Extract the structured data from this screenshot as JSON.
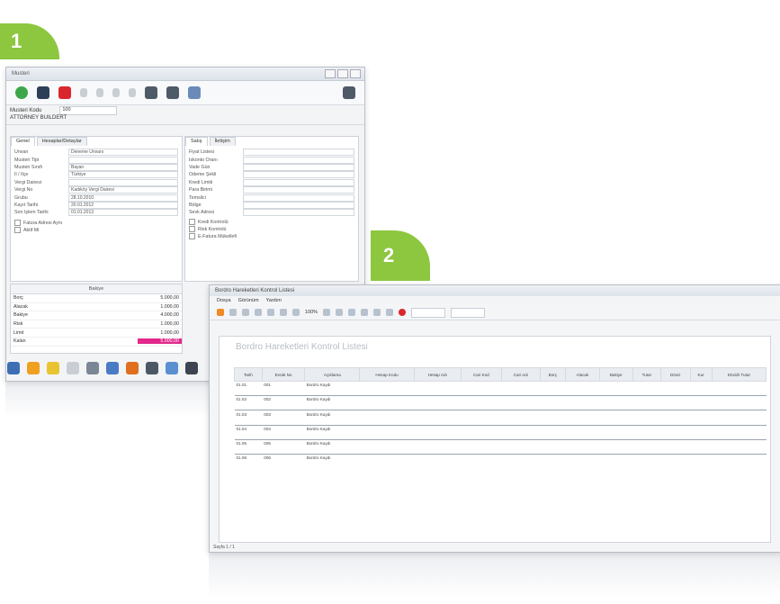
{
  "steps": {
    "one": "1",
    "two": "2"
  },
  "win1": {
    "title": "Musteri",
    "field_code_label": "Musteri Kodu",
    "field_code_value": "100",
    "company": "ATTORNEY BUILDERT",
    "left_tabs": [
      "Genel",
      "Hesaplar/Detaylar"
    ],
    "left_fields": [
      {
        "label": "Unvan",
        "value": "Deneme Unvanı"
      },
      {
        "label": "Musteri Tipi",
        "value": ""
      },
      {
        "label": "Musteri Sınıfı",
        "value": "Bayan"
      },
      {
        "label": "İl / İlçe",
        "value": "Türkiye"
      },
      {
        "label": "Vergi Dairesi",
        "value": ""
      },
      {
        "label": "Vergi No",
        "value": "Kadıköy Vergi Dairesi"
      },
      {
        "label": "Grubu",
        "value": "28.10.2010"
      },
      {
        "label": "Kayıt Tarihi",
        "value": "20.01.2012"
      },
      {
        "label": "Son İşlem Tarihi",
        "value": "01.01.2013"
      }
    ],
    "left_checks": [
      "Fatura Adresi Aynı",
      "Aktif Mi"
    ],
    "right_tabs": [
      "Satış",
      "İletişim"
    ],
    "right_fields": [
      {
        "label": "Fiyat Listesi",
        "value": ""
      },
      {
        "label": "İskonto Oranı",
        "value": ""
      },
      {
        "label": "Vade Gün",
        "value": ""
      },
      {
        "label": "Ödeme Şekli",
        "value": ""
      },
      {
        "label": "Kredi Limiti",
        "value": ""
      },
      {
        "label": "Para Birimi",
        "value": ""
      },
      {
        "label": "Temsilci",
        "value": ""
      },
      {
        "label": "Bölge",
        "value": ""
      },
      {
        "label": "Sevk Adresi",
        "value": ""
      }
    ],
    "right_checks": [
      "Kredi Kontrolü",
      "Risk Kontrolü",
      "E-Fatura Mükellefi"
    ],
    "balance_title": "Bakiye",
    "balance_rows": [
      {
        "label": "Borç",
        "value": "5.000,00"
      },
      {
        "label": "Alacak",
        "value": "1.000,00"
      },
      {
        "label": "Bakiye",
        "value": "4.000,00"
      },
      {
        "label": "Risk",
        "value": "1.000,00"
      },
      {
        "label": "Limit",
        "value": "1.000,00"
      },
      {
        "label": "Kalan",
        "value": "5.000,00",
        "highlight": true
      }
    ]
  },
  "win2": {
    "title": "Bordro Hareketleri Kontrol Listesi",
    "menu": [
      "Dosya",
      "Görünüm",
      "Yardım"
    ],
    "zoom": "100%",
    "report_title": "Bordro Hareketleri Kontrol Listesi",
    "columns": [
      "Tarih",
      "Evrak No",
      "Açıklama",
      "Hesap Kodu",
      "Hesap Adı",
      "Cari Kod",
      "Cari Adı",
      "Borç",
      "Alacak",
      "Bakiye",
      "Tutar",
      "Döviz",
      "Kur",
      "Dövizli Tutar"
    ],
    "rows": [
      [
        "01.01",
        "001",
        "Bordro Kaydı",
        "",
        "",
        "",
        "",
        "",
        "",
        "",
        "",
        "",
        "",
        ""
      ],
      [
        "",
        "",
        "",
        "",
        "",
        "",
        "",
        "",
        "",
        "",
        "",
        "",
        "",
        ""
      ],
      [
        "01.02",
        "002",
        "Bordro Kaydı",
        "",
        "",
        "",
        "",
        "",
        "",
        "",
        "",
        "",
        "",
        ""
      ],
      [
        "",
        "",
        "",
        "",
        "",
        "",
        "",
        "",
        "",
        "",
        "",
        "",
        "",
        ""
      ],
      [
        "01.03",
        "003",
        "Bordro Kaydı",
        "",
        "",
        "",
        "",
        "",
        "",
        "",
        "",
        "",
        "",
        ""
      ],
      [
        "",
        "",
        "",
        "",
        "",
        "",
        "",
        "",
        "",
        "",
        "",
        "",
        "",
        ""
      ],
      [
        "01.04",
        "004",
        "Bordro Kaydı",
        "",
        "",
        "",
        "",
        "",
        "",
        "",
        "",
        "",
        "",
        ""
      ],
      [
        "",
        "",
        "",
        "",
        "",
        "",
        "",
        "",
        "",
        "",
        "",
        "",
        "",
        ""
      ],
      [
        "01.05",
        "005",
        "Bordro Kaydı",
        "",
        "",
        "",
        "",
        "",
        "",
        "",
        "",
        "",
        "",
        ""
      ],
      [
        "",
        "",
        "",
        "",
        "",
        "",
        "",
        "",
        "",
        "",
        "",
        "",
        "",
        ""
      ],
      [
        "01.06",
        "006",
        "Bordro Kaydı",
        "",
        "",
        "",
        "",
        "",
        "",
        "",
        "",
        "",
        "",
        ""
      ]
    ],
    "status": "Sayfa 1 / 1"
  },
  "colors": {
    "accent_green": "#8dc63f",
    "highlight_pink": "#e2288a"
  }
}
